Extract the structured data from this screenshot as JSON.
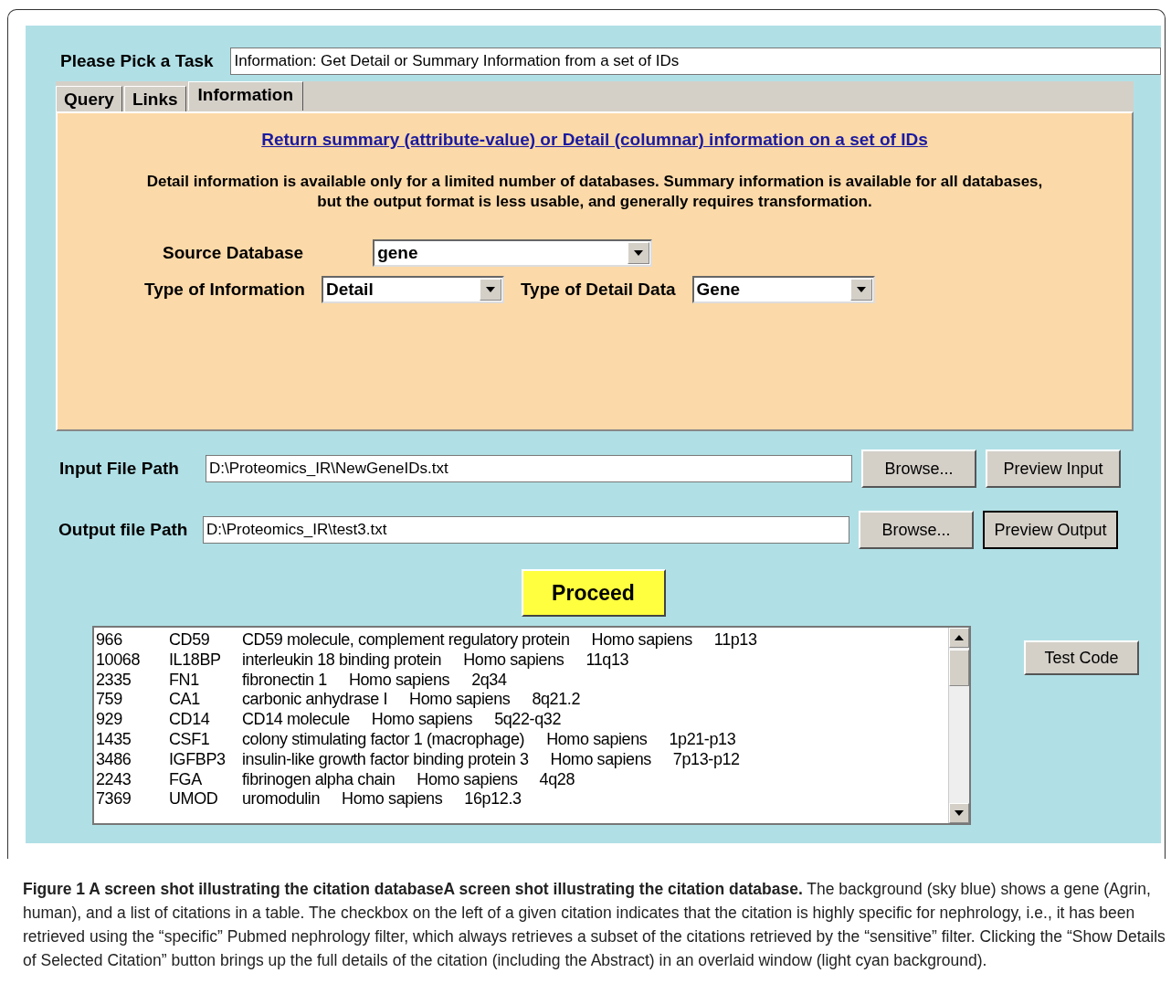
{
  "task": {
    "label": "Please Pick a Task",
    "value": "Information: Get Detail or Summary Information from a set of IDs"
  },
  "tabs": [
    {
      "label": "Query",
      "selected": false
    },
    {
      "label": "Links",
      "selected": false
    },
    {
      "label": "Information",
      "selected": true
    }
  ],
  "panel": {
    "link": "Return summary (attribute-value) or Detail (columnar) information on a set of IDs",
    "description": "Detail information is available only for a limited number of databases. Summary information is available for all databases, but the output format is less usable, and generally requires transformation.",
    "source_database": {
      "label": "Source Database",
      "value": "gene"
    },
    "type_of_information": {
      "label": "Type of Information",
      "value": "Detail"
    },
    "type_of_detail_data": {
      "label": "Type of Detail Data",
      "value": "Gene"
    }
  },
  "files": [
    {
      "label": "Input File Path",
      "value": "D:\\Proteomics_IR\\NewGeneIDs.txt",
      "browse": "Browse...",
      "preview": "Preview Input",
      "focused": false
    },
    {
      "label": "Output file Path",
      "value": "D:\\Proteomics_IR\\test3.txt",
      "browse": "Browse...",
      "preview": "Preview Output",
      "focused": true
    }
  ],
  "proceed": "Proceed",
  "results": [
    {
      "id": "966",
      "symbol": "CD59",
      "name": "CD59 molecule, complement regulatory protein",
      "species": "Homo sapiens",
      "location": "11p13"
    },
    {
      "id": "10068",
      "symbol": "IL18BP",
      "name": "interleukin 18 binding protein",
      "species": "Homo sapiens",
      "location": "11q13"
    },
    {
      "id": "2335",
      "symbol": "FN1",
      "name": "fibronectin 1",
      "species": "Homo sapiens",
      "location": "2q34"
    },
    {
      "id": "759",
      "symbol": "CA1",
      "name": "carbonic anhydrase I",
      "species": "Homo sapiens",
      "location": "8q21.2"
    },
    {
      "id": "929",
      "symbol": "CD14",
      "name": "CD14 molecule",
      "species": "Homo sapiens",
      "location": "5q22-q32"
    },
    {
      "id": "1435",
      "symbol": "CSF1",
      "name": "colony stimulating factor 1 (macrophage)",
      "species": "Homo sapiens",
      "location": "1p21-p13"
    },
    {
      "id": "3486",
      "symbol": "IGFBP3",
      "name": "insulin-like growth factor binding protein 3",
      "species": "Homo sapiens",
      "location": "7p13-p12"
    },
    {
      "id": "2243",
      "symbol": "FGA",
      "name": "fibrinogen alpha chain",
      "species": "Homo sapiens",
      "location": "4q28"
    },
    {
      "id": "7369",
      "symbol": "UMOD",
      "name": "uromodulin",
      "species": "Homo sapiens",
      "location": "16p12.3"
    }
  ],
  "test_code": "Test Code",
  "caption": "**Figure 1 A screen shot illustrating the citation databaseA screen shot illustrating the citation database.** The background (sky blue) shows a gene (Agrin, human), and a list of citations in a table. The checkbox on the left of a given citation indicates that the citation is highly specific for nephrology, i.e., it has been retrieved using the “specific” Pubmed nephrology filter, which always retrieves a subset of the citations retrieved by the “sensitive” filter. Clicking the “Show Details of Selected Citation” button brings up the full details of the citation (including the Abstract) in an overlaid window (light cyan background)."
}
